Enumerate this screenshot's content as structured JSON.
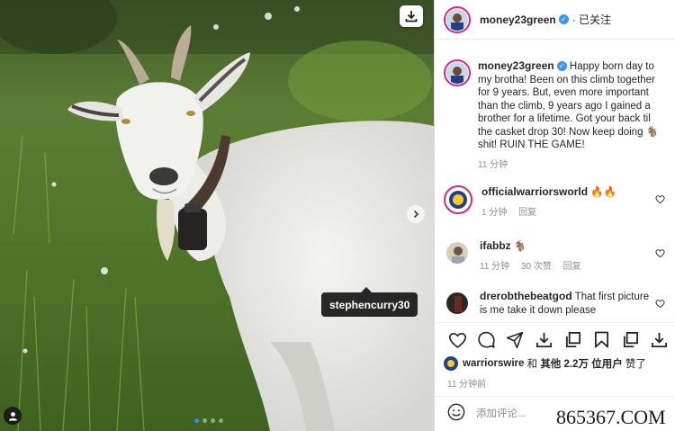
{
  "post": {
    "username": "money23green",
    "follow_status": "· 已关注",
    "caption": "Happy born day to my brotha! Been on this climb together for 9 years. But, even more important than the climb, 9 years ago I gained a brother for a lifetime. Got your back til the casket drop 30! Now keep doing 🐐shit! RUIN THE GAME!",
    "caption_time": "11 分钟",
    "photo_tag": "stephencurry30"
  },
  "comments": [
    {
      "username": "officialwarriorsworld",
      "text": "🔥🔥",
      "time": "1 分钟",
      "reply": "回复"
    },
    {
      "username": "ifabbz",
      "text": "🐐",
      "time": "11 分钟",
      "likes": "30 次赞",
      "reply": "回复"
    },
    {
      "username": "drerobthebeatgod",
      "text": "That first picture is me take it down please",
      "time": "",
      "reply": ""
    }
  ],
  "likes": {
    "user": "warriorswire",
    "and": "和",
    "others": "其他 2.2万 位用户",
    "suffix": "赞了"
  },
  "posted_ago": "11 分钟前",
  "comment_input": {
    "placeholder": "添加评论..."
  },
  "watermark": "865367.COM",
  "icons": {
    "download": "download-icon",
    "next": "chevron-right-icon",
    "user_tag": "user-icon",
    "like": "heart-icon",
    "comment": "comment-bubble-icon",
    "share": "paper-plane-icon",
    "save": "bookmark-icon"
  },
  "colors": {
    "verified": "#3897f0",
    "story_ring": "#d62976",
    "text": "#262626",
    "muted": "#8e8e8e",
    "dot_active": "#2f8ef4"
  }
}
